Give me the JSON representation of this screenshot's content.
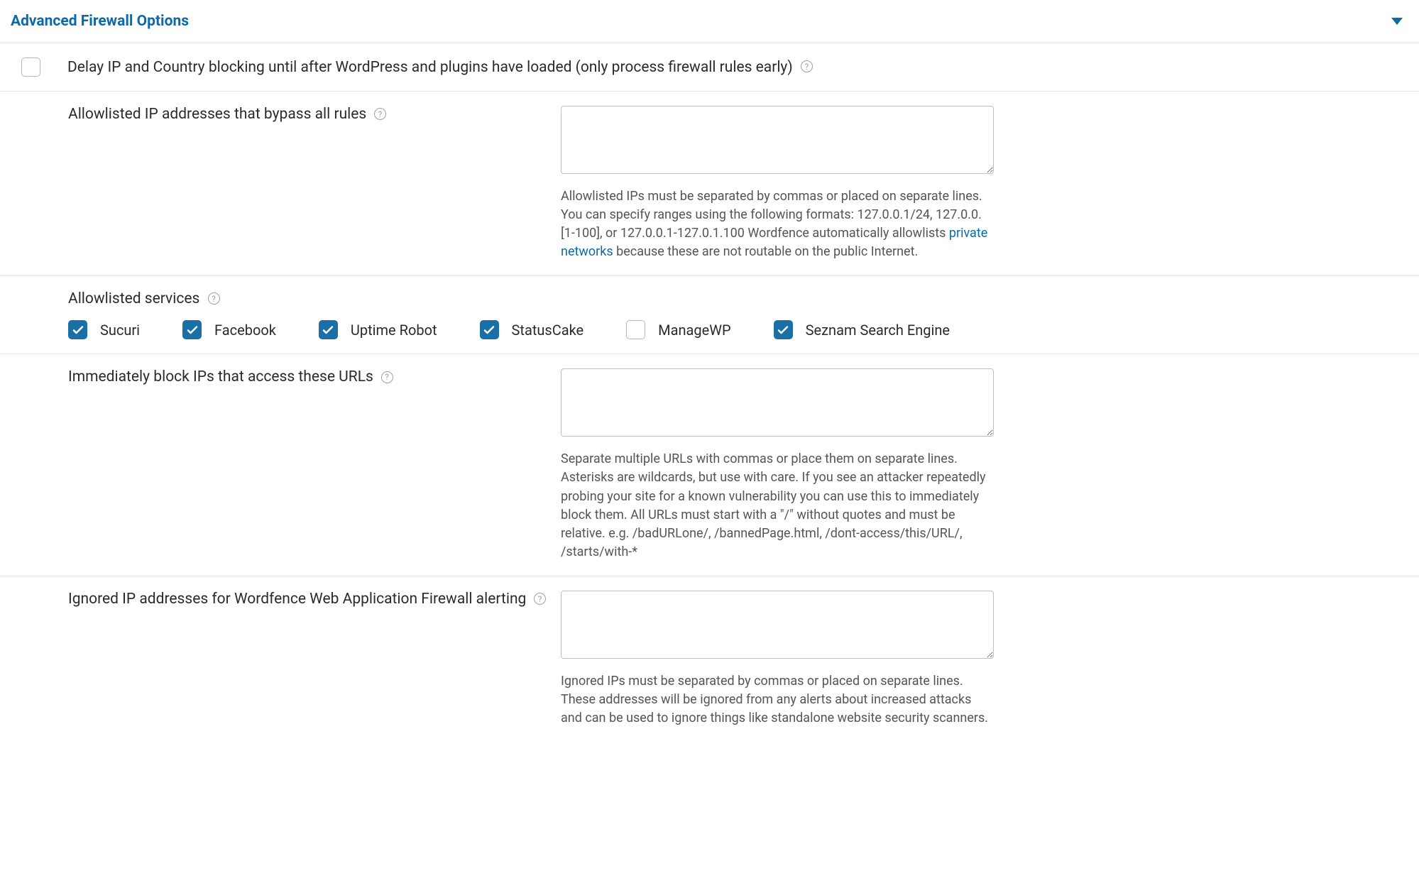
{
  "header": {
    "title": "Advanced Firewall Options"
  },
  "delay_blocking": {
    "label": "Delay IP and Country blocking until after WordPress and plugins have loaded (only process firewall rules early)",
    "checked": false
  },
  "allowlisted_ips": {
    "label": "Allowlisted IP addresses that bypass all rules",
    "value": "",
    "help_pre": "Allowlisted IPs must be separated by commas or placed on separate lines. You can specify ranges using the following formats: 127.0.0.1/24, 127.0.0.[1-100], or 127.0.0.1-127.0.1.100 Wordfence automatically allowlists ",
    "help_link": "private networks",
    "help_post": " because these are not routable on the public Internet."
  },
  "allowlisted_services": {
    "label": "Allowlisted services",
    "items": [
      {
        "name": "Sucuri",
        "checked": true
      },
      {
        "name": "Facebook",
        "checked": true
      },
      {
        "name": "Uptime Robot",
        "checked": true
      },
      {
        "name": "StatusCake",
        "checked": true
      },
      {
        "name": "ManageWP",
        "checked": false
      },
      {
        "name": "Seznam Search Engine",
        "checked": true
      }
    ]
  },
  "block_urls": {
    "label": "Immediately block IPs that access these URLs",
    "value": "",
    "help": "Separate multiple URLs with commas or place them on separate lines. Asterisks are wildcards, but use with care. If you see an attacker repeatedly probing your site for a known vulnerability you can use this to immediately block them. All URLs must start with a \"/\" without quotes and must be relative. e.g. /badURLone/, /bannedPage.html, /dont-access/this/URL/, /starts/with-*"
  },
  "ignored_ips": {
    "label": "Ignored IP addresses for Wordfence Web Application Firewall alerting",
    "value": "",
    "help": "Ignored IPs must be separated by commas or placed on separate lines. These addresses will be ignored from any alerts about increased attacks and can be used to ignore things like standalone website security scanners."
  }
}
